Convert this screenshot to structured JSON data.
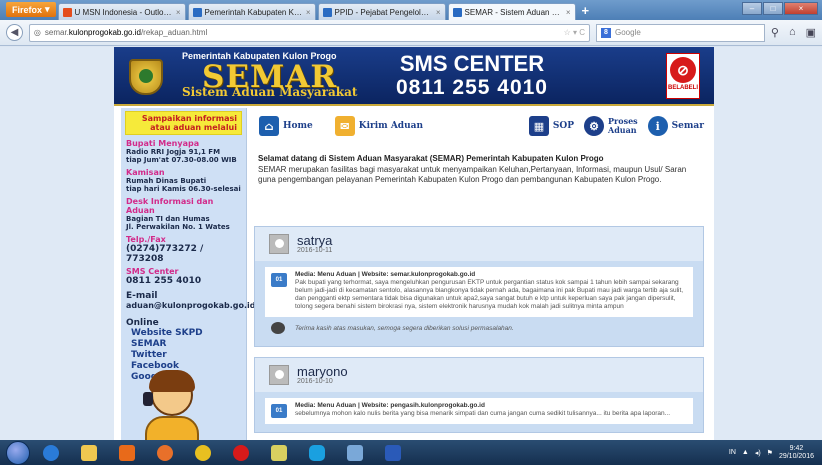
{
  "browser": {
    "app_button": "Firefox",
    "tabs": [
      {
        "label": "U MSN Indonesia - Outlook, Skype, H...",
        "color": "#e44d1d"
      },
      {
        "label": "Pemerintah Kabupaten Kulon Progo",
        "color": "#2a6bc2"
      },
      {
        "label": "PPID - Pejabat Pengelola Informasi d...",
        "color": "#2a6bc2"
      },
      {
        "label": "SEMAR - Sistem Aduan Masyarakat K...",
        "color": "#2a6bc2"
      }
    ],
    "new_tab": "+",
    "url_prefix": "semar.",
    "url_domain": "kulonprogokab.go.id",
    "url_path": "/rekap_aduan.html",
    "search_placeholder": "Google",
    "search_engine_icon": "google-icon"
  },
  "banner": {
    "subtitle": "Pemerintah Kabupaten Kulon Progo",
    "title": "SEMAR",
    "tagline": "Sistem Aduan Masyarakat",
    "sms_center": "SMS CENTER",
    "sms_number": "0811 255 4010",
    "belabeli": "BELABELI"
  },
  "sidebar": {
    "info_box": "Sampaikan informasi atau aduan melalui",
    "sections": [
      {
        "heading": "Bupati Menyapa",
        "lines": [
          "Radio RRI Jogja 91,1 FM",
          "tiap Jum'at  07.30-08.00 WIB"
        ]
      },
      {
        "heading": "Kamisan",
        "lines": [
          "Rumah Dinas Bupati",
          "tiap hari Kamis 06.30-selesai"
        ]
      },
      {
        "heading": "Desk Informasi dan Aduan",
        "lines": [
          "Bagian TI dan Humas",
          "Jl. Perwakilan No. 1 Wates"
        ]
      }
    ],
    "telp_label": "Telp./Fax",
    "telp_value": "(0274)773272 / 773208",
    "sms_label": "SMS Center",
    "sms_value": "0811 255 4010",
    "email_label": "E-mail",
    "email_value": "aduan@kulonprogokab.go.id",
    "online_label": "Online",
    "online_links": [
      "Website SKPD",
      "SEMAR",
      "Twitter",
      "Facebook",
      "Google+"
    ]
  },
  "menu": {
    "home": "Home",
    "kirim": "Kirim Aduan",
    "sop": "SOP",
    "proses_line1": "Proses",
    "proses_line2": "Aduan",
    "semar": "Semar"
  },
  "welcome": {
    "title": "Selamat datang di Sistem Aduan Masyarakat (SEMAR) Pemerintah Kabupaten Kulon Progo",
    "text": "SEMAR merupakan fasilitas bagi masyarakat untuk menyampaikan Keluhan,Pertanyaan, Informasi, maupun Usul/ Saran guna pengembangan pelayanan Pemerintah Kabupaten Kulon Progo dan pembangunan Kabupaten Kulon Progo."
  },
  "posts": [
    {
      "name": "satrya",
      "date": "2016-10-11",
      "meta": "Media: Menu Aduan | Website: semar.kulonprogokab.go.id",
      "body": "Pak bupati yang terhormat, saya mengeluhkan pengurusan EKTP untuk pergantian status kok sampai 1 tahun lebih sampai sekarang belum jadi-jadi di kecamatan sentolo, alasannya blangkonya tidak pernah ada, bagaimana ini pak Bupati mau jadi warga tertib aja sulit, dan pengganti ektp sementara tidak bisa digunakan untuk apa2,saya sangat butuh e ktp untuk keperluan saya pak jangan dipersulit, tolong segera benahi sistem birokrasi nya, sistem elektronik harusnya mudah kok malah jadi sulitnya minta ampun",
      "reply": "Terima kasih atas masukan, semoga segera diberikan solusi permasalahan."
    },
    {
      "name": "maryono",
      "date": "2016-10-10",
      "meta": "Media: Menu Aduan | Website: pengasih.kulonprogokab.go.id",
      "body": "sebelumnya mohon kalo nulis berita yang bisa menarik simpati dan cuma jangan cuma sedikit tulisannya... itu berita apa laporan..."
    }
  ],
  "taskbar": {
    "lang": "IN",
    "time": "9:42",
    "date": "29/10/2016"
  }
}
